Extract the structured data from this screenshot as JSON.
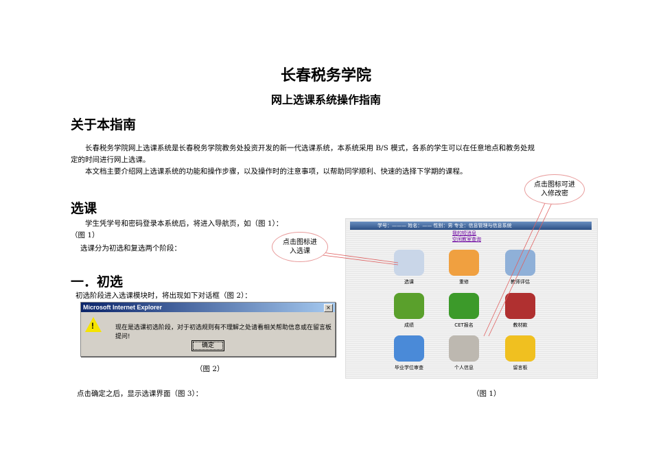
{
  "title": "长春税务学院",
  "subtitle": "网上选课系统操作指南",
  "about": {
    "heading": "关于本指南",
    "p1": "长春税务学院网上选课系统是长春税务学院教务处投资开发的新一代选课系统，本系统采用 B/S 模式，各系的学生可以在任意地点和教务处规",
    "p1b": "定的时间进行网上选课。",
    "p2": "本文档主要介绍网上选课系统的功能和操作步骤，以及操作时的注意事项，以帮助同学顺利、快速的选择下学期的课程。"
  },
  "select": {
    "heading": "选课",
    "p1": "学生凭学号和密码登录本系统后，将进入导航页，如（图 1）：",
    "fig1a": "（图 1）",
    "p2": "选课分为初选和复选两个阶段："
  },
  "initial": {
    "heading": "一．初选",
    "p1": "初选阶段进入选课模块时，将出现如下对话框（图 2）：",
    "fig2": "（图 2）",
    "p2": "点击确定之后，显示选课界面（图 3）：",
    "fig1": "（图 1）"
  },
  "dialog": {
    "title": "Microsoft Internet Explorer",
    "close": "×",
    "message": "现在是选课初选阶段，对于初选规则有不理解之处请看相关帮助信息或在留言板提问!",
    "ok": "确定"
  },
  "nav": {
    "header": "学号：———  姓名：——  性别：男  专业：信息管理与信息系统",
    "link1": "我的短消息",
    "link2": "空闲教室查询",
    "icons": [
      {
        "label": "选课",
        "color": "#c9d6e8"
      },
      {
        "label": "重修",
        "color": "#f0a040"
      },
      {
        "label": "教师评估",
        "color": "#8fb0d8"
      },
      {
        "label": "成绩",
        "color": "#5aa02c"
      },
      {
        "label": "CET报名",
        "color": "#3c9a2a"
      },
      {
        "label": "教材款",
        "color": "#b03030"
      },
      {
        "label": "毕业学位审查",
        "color": "#4a8ad8"
      },
      {
        "label": "个人信息",
        "color": "#bdb8b0"
      },
      {
        "label": "留言板",
        "color": "#f0c020"
      }
    ]
  },
  "callouts": {
    "c1": "点击图标进入选课",
    "c2": "点击图标可进入修改密"
  }
}
